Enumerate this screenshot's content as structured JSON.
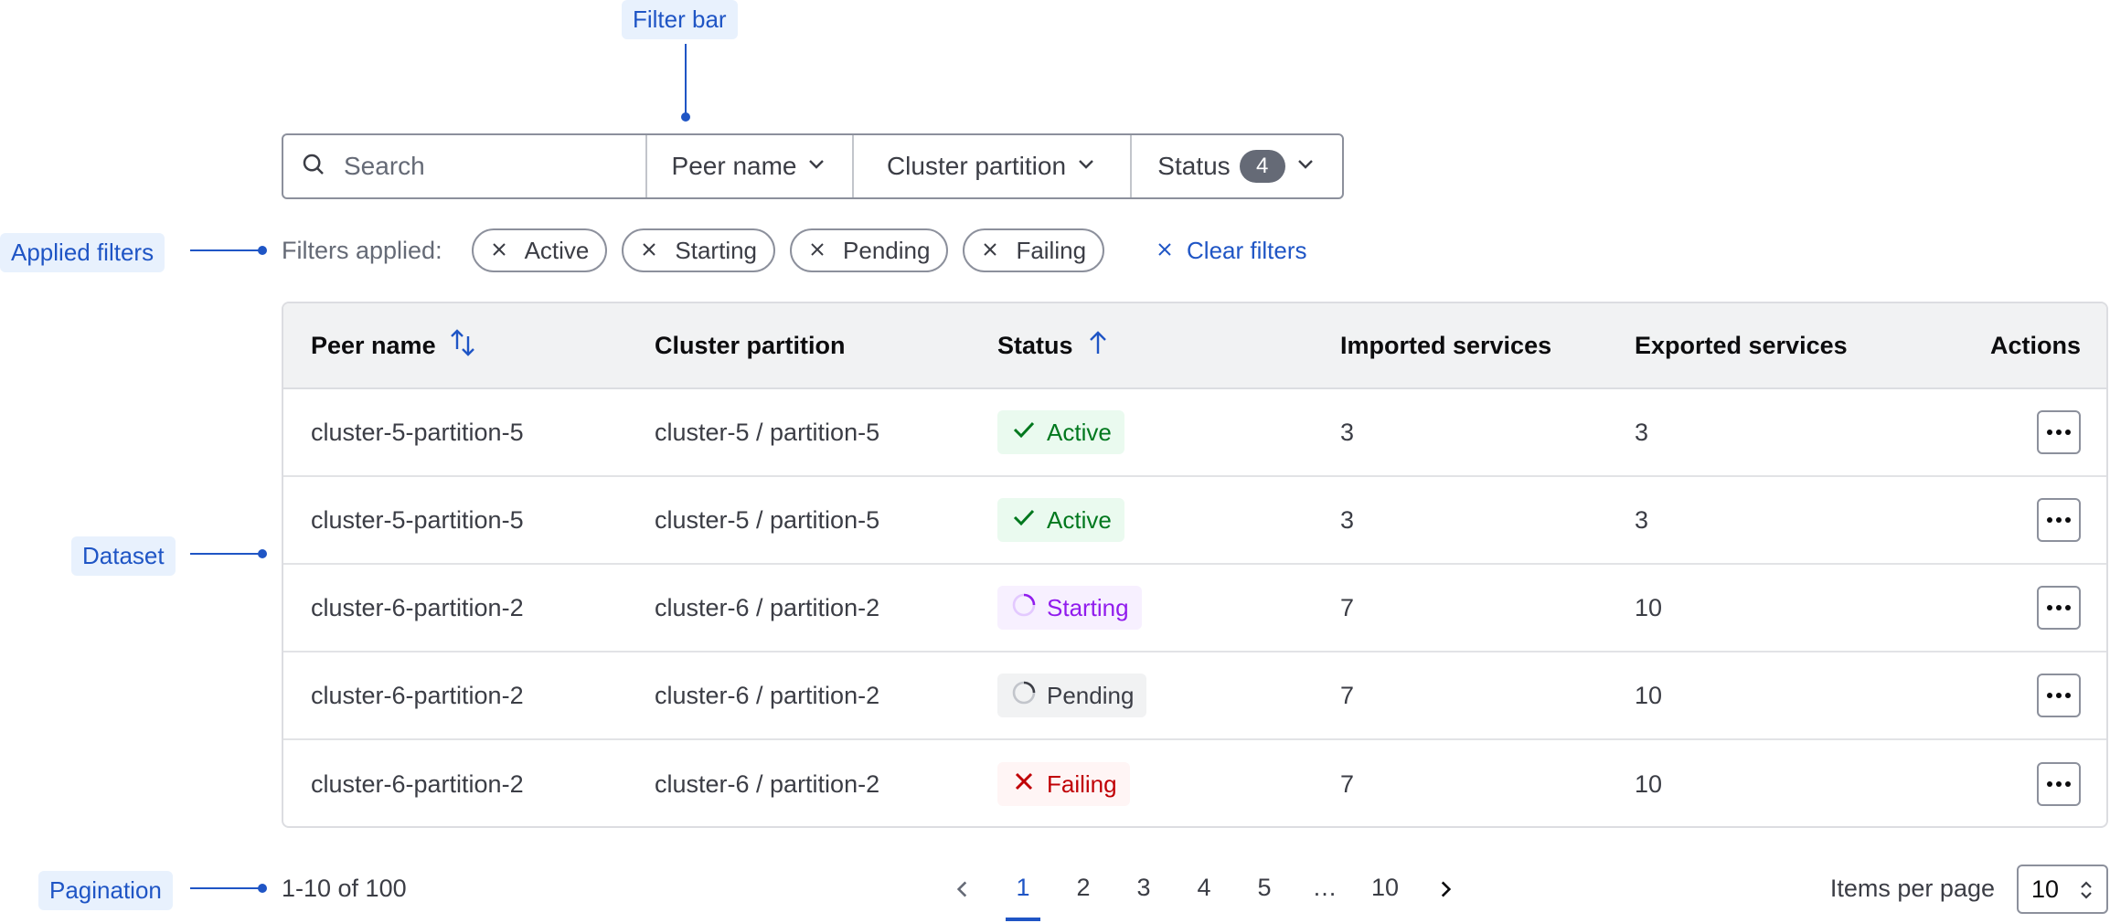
{
  "callouts": {
    "filter_bar": "Filter bar",
    "applied_filters": "Applied filters",
    "dataset": "Dataset",
    "pagination": "Pagination"
  },
  "filter_bar": {
    "search_placeholder": "Search",
    "buttons": [
      {
        "label": "Peer name",
        "icon": "chevron-down-icon"
      },
      {
        "label": "Cluster partition",
        "icon": "chevron-down-icon"
      },
      {
        "label": "Status",
        "count": "4",
        "icon": "chevron-down-icon"
      }
    ]
  },
  "applied_filters": {
    "label": "Filters applied:",
    "chips": [
      "Active",
      "Starting",
      "Pending",
      "Failing"
    ],
    "clear_label": "Clear filters"
  },
  "table": {
    "columns": [
      "Peer name",
      "Cluster partition",
      "Status",
      "Imported services",
      "Exported services",
      "Actions"
    ],
    "sort": {
      "peer_name": "sortable",
      "status": "ascending"
    },
    "rows": [
      {
        "peer": "cluster-5-partition-5",
        "partition": "cluster-5 / partition-5",
        "status": "Active",
        "imported": "3",
        "exported": "3"
      },
      {
        "peer": "cluster-5-partition-5",
        "partition": "cluster-5 / partition-5",
        "status": "Active",
        "imported": "3",
        "exported": "3"
      },
      {
        "peer": "cluster-6-partition-2",
        "partition": "cluster-6 / partition-2",
        "status": "Starting",
        "imported": "7",
        "exported": "10"
      },
      {
        "peer": "cluster-6-partition-2",
        "partition": "cluster-6 / partition-2",
        "status": "Pending",
        "imported": "7",
        "exported": "10"
      },
      {
        "peer": "cluster-6-partition-2",
        "partition": "cluster-6 / partition-2",
        "status": "Failing",
        "imported": "7",
        "exported": "10"
      }
    ]
  },
  "pagination": {
    "info": "1-10 of 100",
    "pages": [
      "1",
      "2",
      "3",
      "4",
      "5",
      "…",
      "10"
    ],
    "current": "1",
    "items_per_page_label": "Items per page",
    "items_per_page_value": "10"
  },
  "colors": {
    "accent": "#1f55c5",
    "active": "#00781e",
    "starting": "#911ced",
    "failing": "#c00005"
  }
}
